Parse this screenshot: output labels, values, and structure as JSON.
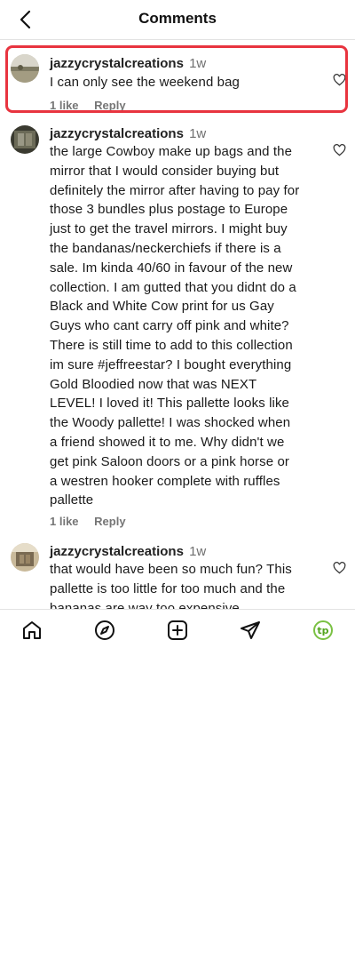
{
  "header": {
    "title": "Comments",
    "back_icon": "chevron-left-icon"
  },
  "comments": [
    {
      "username": "jazzycrystalcreations",
      "time": "1w",
      "text": "I can only see the weekend bag",
      "likes": "1 like",
      "reply": "Reply",
      "highlighted": true
    },
    {
      "username": "jazzycrystalcreations",
      "time": "1w",
      "text": "the large Cowboy make up bags and the mirror that I would consider buying but definitely the mirror after having to pay for those 3 bundles plus postage to Europe just to get the travel mirrors. I might buy the bandanas/neckerchiefs if there is a sale. Im kinda 40/60 in favour of the new collection. I am gutted that you didnt do a Black and White Cow print for us Gay Guys who cant carry off pink and white? There is still time to add to this collection im sure #jeffreestar? I bought everything Gold Bloodied now that was NEXT LEVEL! I loved it! This pallette looks like the Woody pallette! I was shocked when a friend showed it to me. Why didn't we get pink Saloon doors or a pink horse or a westren hooker complete with ruffles pallette",
      "likes": "1 like",
      "reply": "Reply"
    },
    {
      "username": "jazzycrystalcreations",
      "time": "1w",
      "text": "that would have been so much fun? This pallette is too little for too much and the bananas are way too expensive"
    }
  ],
  "bottom_nav": {
    "items": [
      "home-icon",
      "explore-compass-icon",
      "create-plus-icon",
      "direct-send-icon",
      "profile-avatar"
    ],
    "profile_initials": "tp"
  }
}
